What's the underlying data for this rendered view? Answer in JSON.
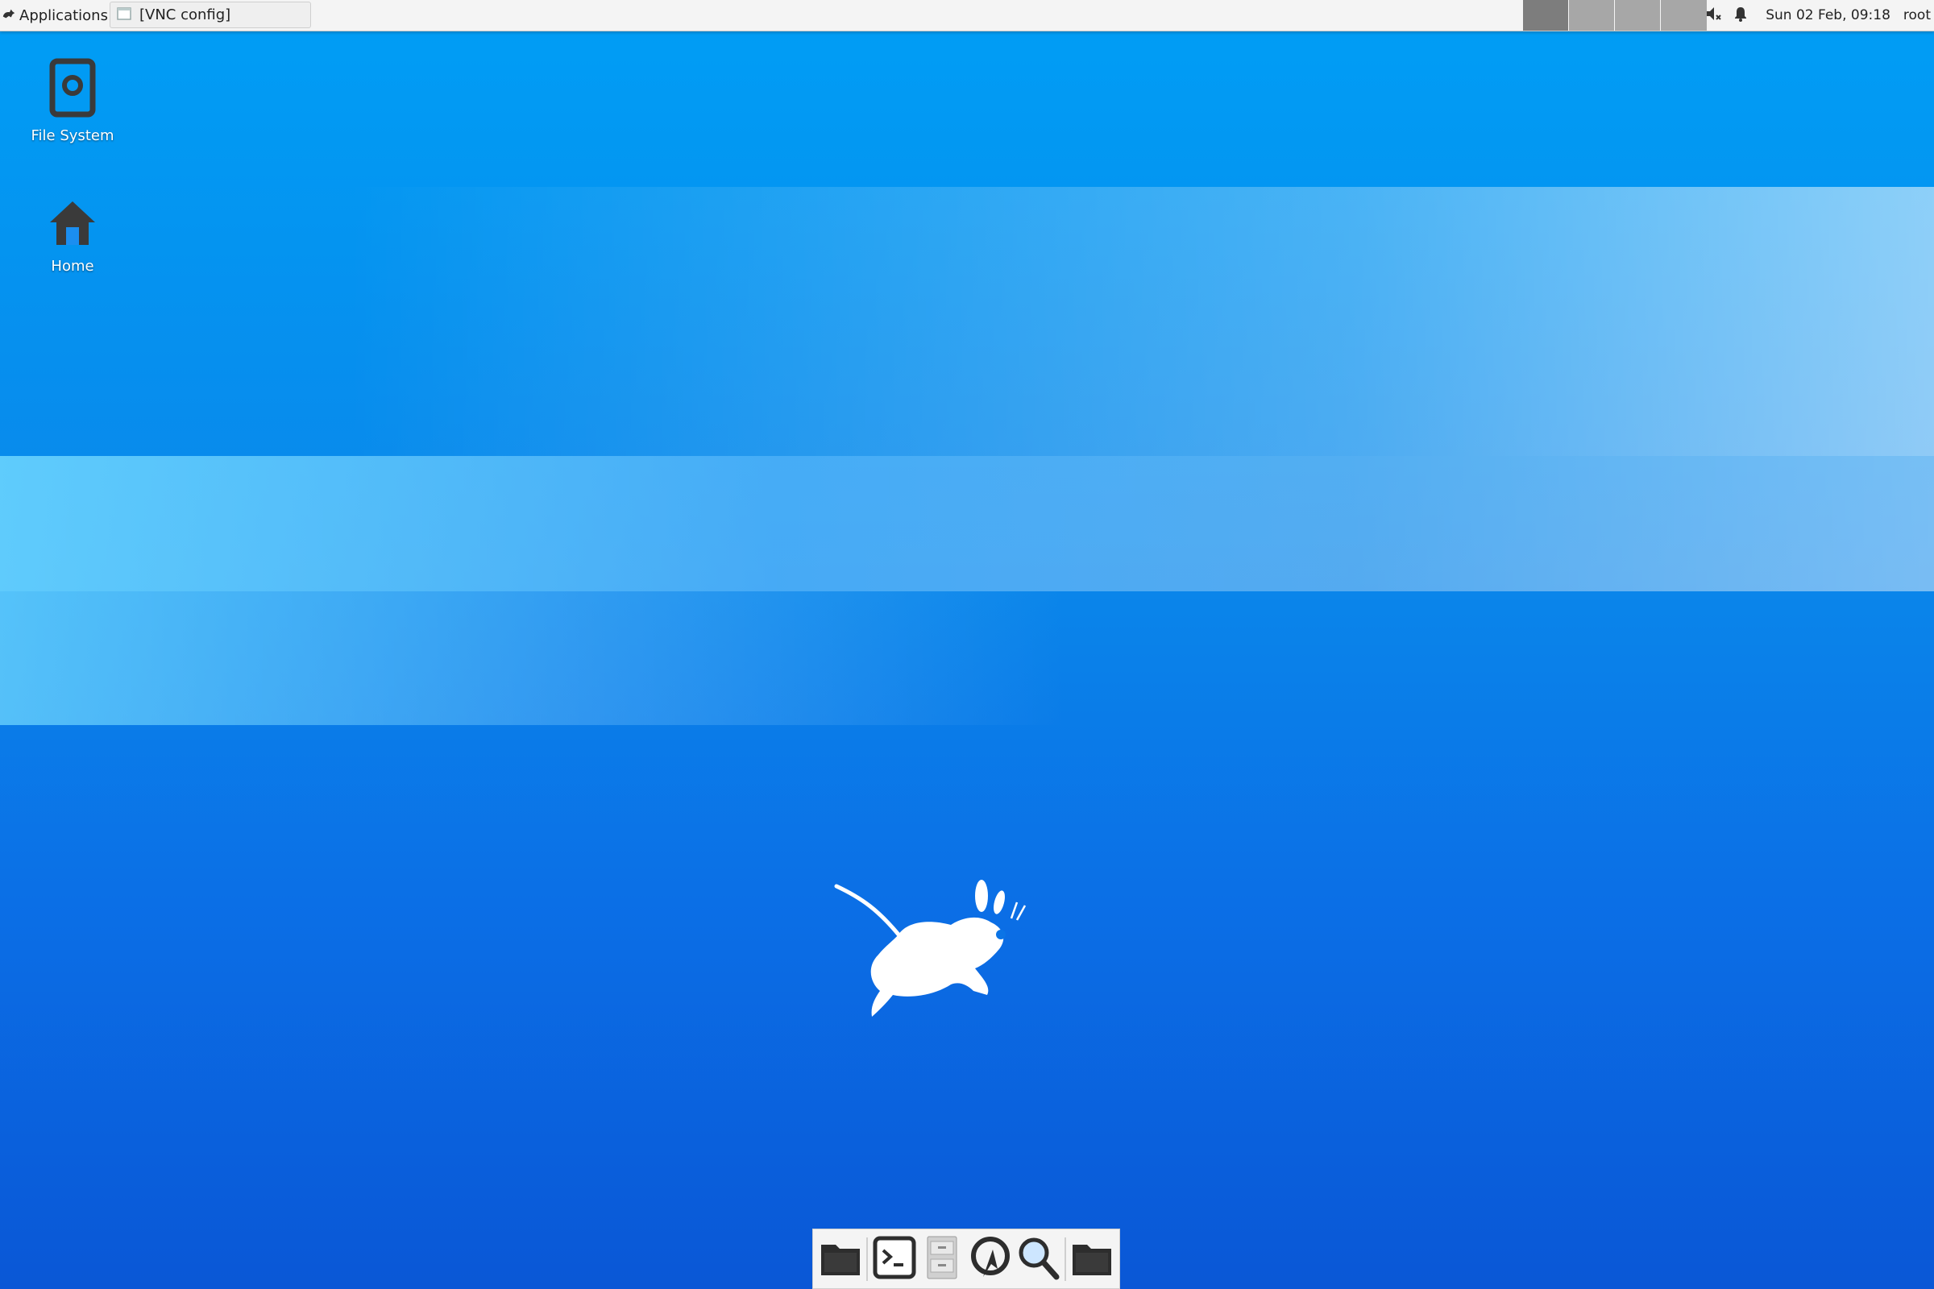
{
  "top_panel": {
    "applications_label": "Applications",
    "task_title": "[VNC config]",
    "workspaces": [
      "ws1",
      "ws2",
      "ws3",
      "ws4"
    ],
    "clock": "Sun 02 Feb, 09:18",
    "user": "root"
  },
  "desktop": {
    "icons": [
      {
        "label": "File System",
        "icon": "drive-icon"
      },
      {
        "label": "Home",
        "icon": "home-icon"
      }
    ]
  },
  "dock": {
    "items": [
      "file-manager-icon",
      "terminal-icon",
      "file-cabinet-icon",
      "browser-icon",
      "search-icon",
      "folder-icon"
    ]
  },
  "colors": {
    "accent": "#0b7ae8",
    "panel": "#f4f4f4",
    "icon_dark": "#3a3a3a"
  }
}
